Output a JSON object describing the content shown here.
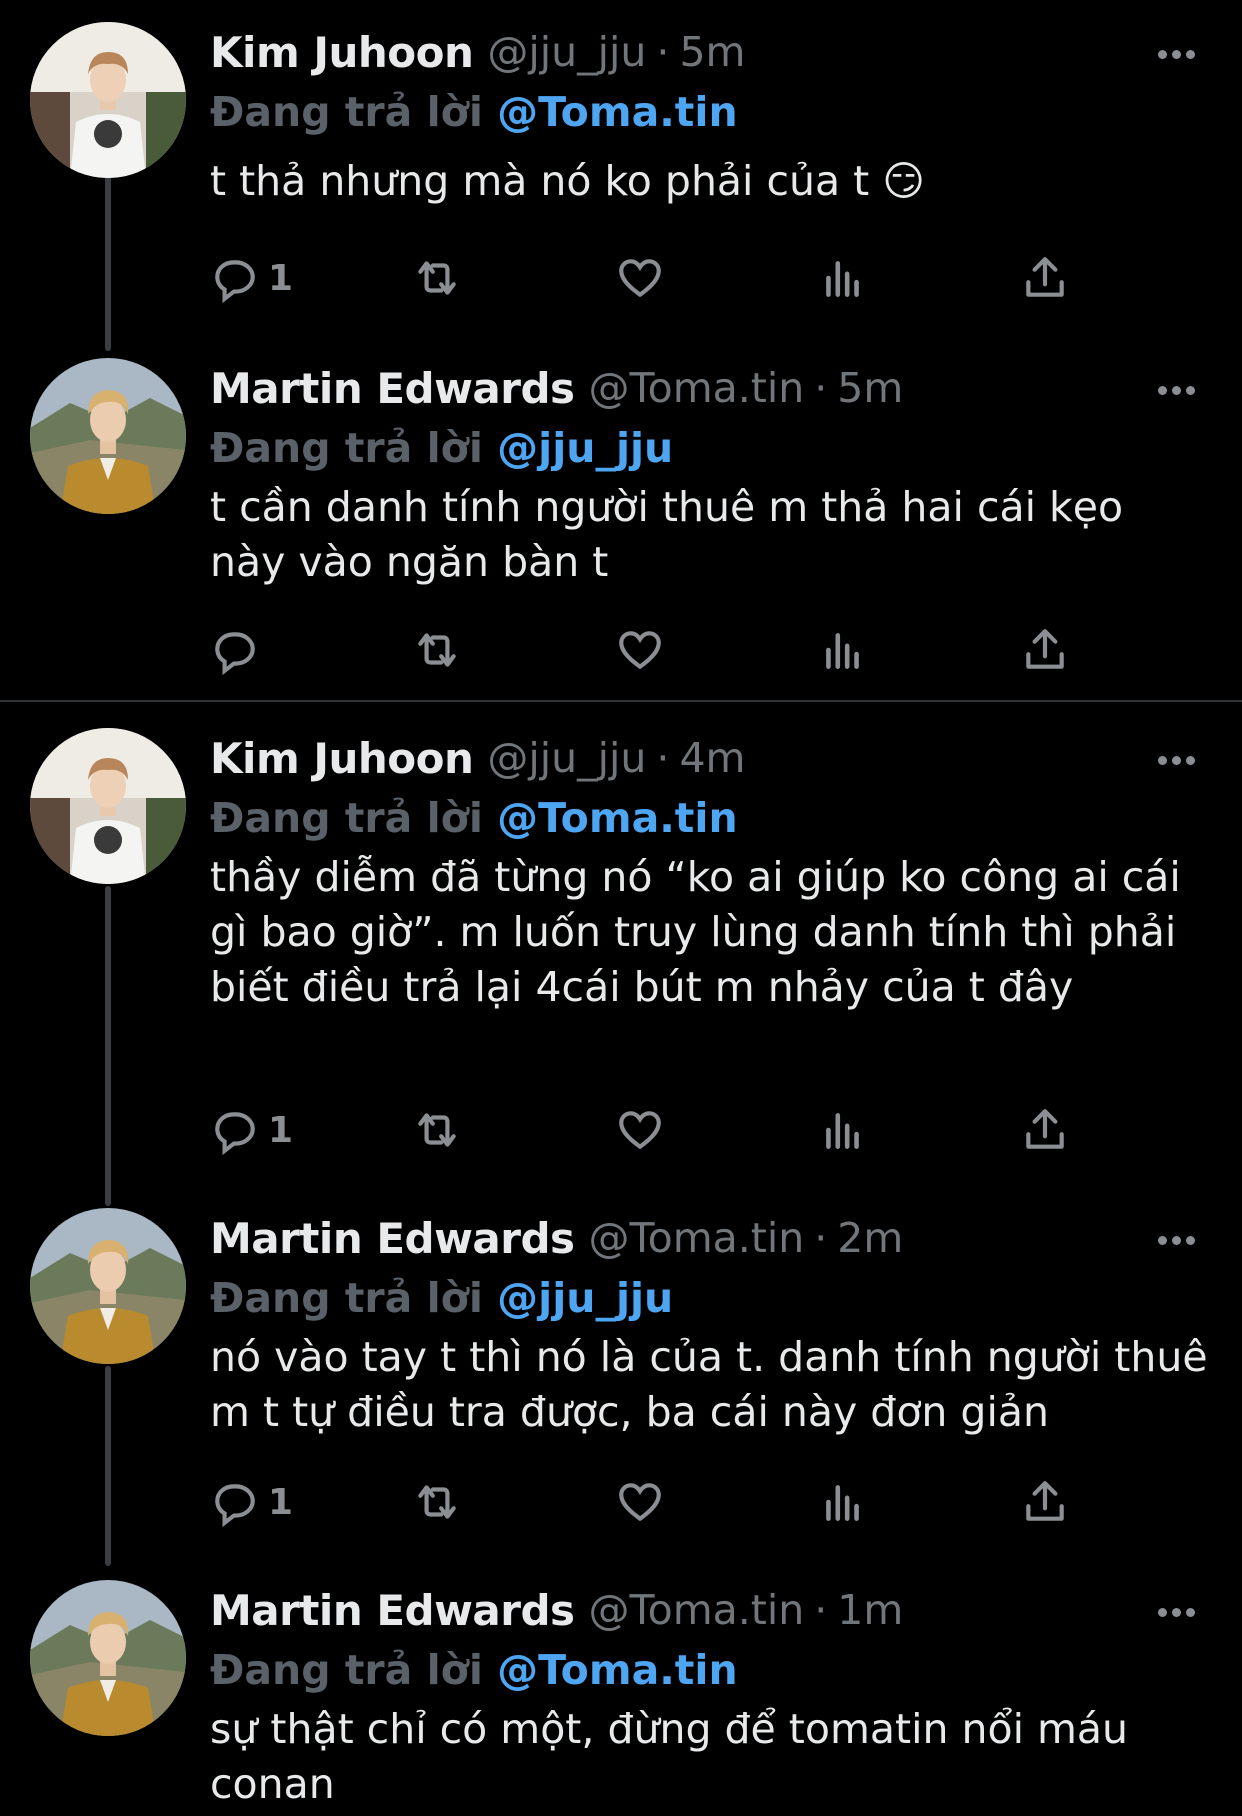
{
  "tweets": [
    {
      "name": "Kim Juhoon",
      "handle": "@jju_jju",
      "dot": "·",
      "time": "5m",
      "replying_prefix": "Đang trả lời",
      "replying_to": "@Toma.tin",
      "text": "t thả nhưng mà nó ko phải của t 😏",
      "reply_count": "1",
      "avatar": "kim-juhoon"
    },
    {
      "name": "Martin Edwards",
      "handle": "@Toma.tin",
      "dot": "·",
      "time": "5m",
      "replying_prefix": "Đang trả lời",
      "replying_to": "@jju_jju",
      "text": "t cần danh tính người thuê m thả hai cái kẹo này vào ngăn bàn t",
      "reply_count": "",
      "avatar": "martin-edwards"
    },
    {
      "name": "Kim Juhoon",
      "handle": "@jju_jju",
      "dot": "·",
      "time": "4m",
      "replying_prefix": "Đang trả lời",
      "replying_to": "@Toma.tin",
      "text": "thầy diễm đã từng nó “ko ai giúp ko công ai cái gì bao giờ”. m luốn truy lùng danh tính thì phải biết điều trả lại 4cái bút m nhảy của t đây",
      "reply_count": "1",
      "avatar": "kim-juhoon"
    },
    {
      "name": "Martin Edwards",
      "handle": "@Toma.tin",
      "dot": "·",
      "time": "2m",
      "replying_prefix": "Đang trả lời",
      "replying_to": "@jju_jju",
      "text": "nó vào tay t thì nó là của t. danh tính người thuê m t tự điều tra được, ba cái này đơn giản",
      "reply_count": "1",
      "avatar": "martin-edwards"
    },
    {
      "name": "Martin Edwards",
      "handle": "@Toma.tin",
      "dot": "·",
      "time": "1m",
      "replying_prefix": "Đang trả lời",
      "replying_to": "@Toma.tin",
      "text": "sự thật chỉ có một, đừng để tomatin nổi máu conan",
      "reply_count": "",
      "avatar": "martin-edwards"
    }
  ],
  "icons": [
    "reply-icon",
    "retweet-icon",
    "like-icon",
    "analytics-icon",
    "share-icon",
    "more-icon"
  ],
  "colors": {
    "background": "#000000",
    "text": "#e7e9ea",
    "muted": "#71767b",
    "mention": "#4ea5f2",
    "divider": "#2f3336"
  }
}
